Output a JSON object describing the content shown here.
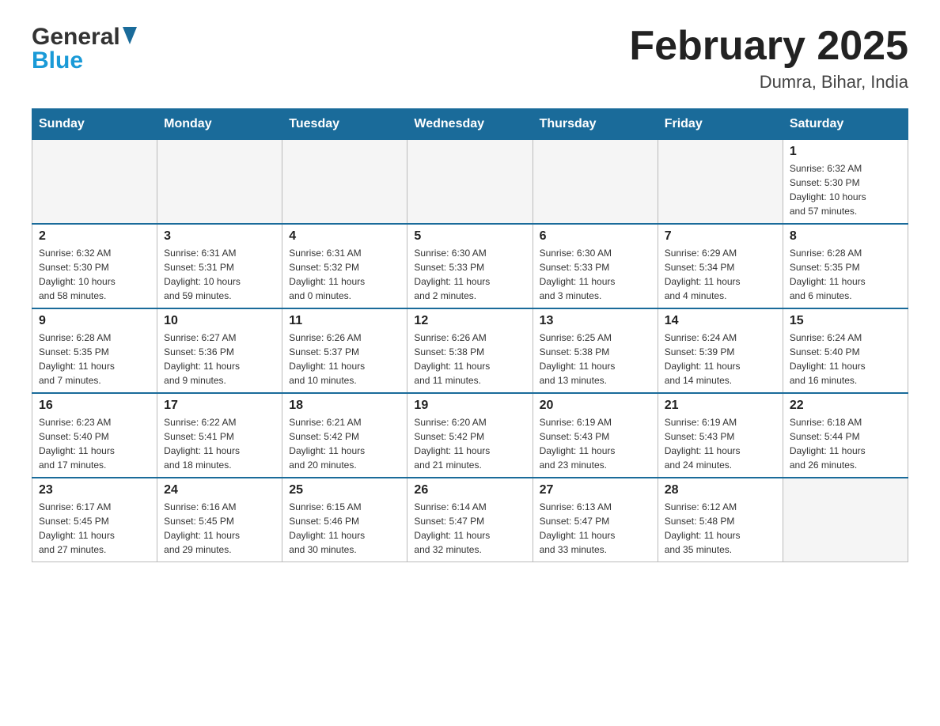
{
  "header": {
    "logo_general": "General",
    "logo_blue": "Blue",
    "title": "February 2025",
    "location": "Dumra, Bihar, India"
  },
  "calendar": {
    "days_of_week": [
      "Sunday",
      "Monday",
      "Tuesday",
      "Wednesday",
      "Thursday",
      "Friday",
      "Saturday"
    ],
    "weeks": [
      [
        {
          "day": "",
          "info": ""
        },
        {
          "day": "",
          "info": ""
        },
        {
          "day": "",
          "info": ""
        },
        {
          "day": "",
          "info": ""
        },
        {
          "day": "",
          "info": ""
        },
        {
          "day": "",
          "info": ""
        },
        {
          "day": "1",
          "info": "Sunrise: 6:32 AM\nSunset: 5:30 PM\nDaylight: 10 hours\nand 57 minutes."
        }
      ],
      [
        {
          "day": "2",
          "info": "Sunrise: 6:32 AM\nSunset: 5:30 PM\nDaylight: 10 hours\nand 58 minutes."
        },
        {
          "day": "3",
          "info": "Sunrise: 6:31 AM\nSunset: 5:31 PM\nDaylight: 10 hours\nand 59 minutes."
        },
        {
          "day": "4",
          "info": "Sunrise: 6:31 AM\nSunset: 5:32 PM\nDaylight: 11 hours\nand 0 minutes."
        },
        {
          "day": "5",
          "info": "Sunrise: 6:30 AM\nSunset: 5:33 PM\nDaylight: 11 hours\nand 2 minutes."
        },
        {
          "day": "6",
          "info": "Sunrise: 6:30 AM\nSunset: 5:33 PM\nDaylight: 11 hours\nand 3 minutes."
        },
        {
          "day": "7",
          "info": "Sunrise: 6:29 AM\nSunset: 5:34 PM\nDaylight: 11 hours\nand 4 minutes."
        },
        {
          "day": "8",
          "info": "Sunrise: 6:28 AM\nSunset: 5:35 PM\nDaylight: 11 hours\nand 6 minutes."
        }
      ],
      [
        {
          "day": "9",
          "info": "Sunrise: 6:28 AM\nSunset: 5:35 PM\nDaylight: 11 hours\nand 7 minutes."
        },
        {
          "day": "10",
          "info": "Sunrise: 6:27 AM\nSunset: 5:36 PM\nDaylight: 11 hours\nand 9 minutes."
        },
        {
          "day": "11",
          "info": "Sunrise: 6:26 AM\nSunset: 5:37 PM\nDaylight: 11 hours\nand 10 minutes."
        },
        {
          "day": "12",
          "info": "Sunrise: 6:26 AM\nSunset: 5:38 PM\nDaylight: 11 hours\nand 11 minutes."
        },
        {
          "day": "13",
          "info": "Sunrise: 6:25 AM\nSunset: 5:38 PM\nDaylight: 11 hours\nand 13 minutes."
        },
        {
          "day": "14",
          "info": "Sunrise: 6:24 AM\nSunset: 5:39 PM\nDaylight: 11 hours\nand 14 minutes."
        },
        {
          "day": "15",
          "info": "Sunrise: 6:24 AM\nSunset: 5:40 PM\nDaylight: 11 hours\nand 16 minutes."
        }
      ],
      [
        {
          "day": "16",
          "info": "Sunrise: 6:23 AM\nSunset: 5:40 PM\nDaylight: 11 hours\nand 17 minutes."
        },
        {
          "day": "17",
          "info": "Sunrise: 6:22 AM\nSunset: 5:41 PM\nDaylight: 11 hours\nand 18 minutes."
        },
        {
          "day": "18",
          "info": "Sunrise: 6:21 AM\nSunset: 5:42 PM\nDaylight: 11 hours\nand 20 minutes."
        },
        {
          "day": "19",
          "info": "Sunrise: 6:20 AM\nSunset: 5:42 PM\nDaylight: 11 hours\nand 21 minutes."
        },
        {
          "day": "20",
          "info": "Sunrise: 6:19 AM\nSunset: 5:43 PM\nDaylight: 11 hours\nand 23 minutes."
        },
        {
          "day": "21",
          "info": "Sunrise: 6:19 AM\nSunset: 5:43 PM\nDaylight: 11 hours\nand 24 minutes."
        },
        {
          "day": "22",
          "info": "Sunrise: 6:18 AM\nSunset: 5:44 PM\nDaylight: 11 hours\nand 26 minutes."
        }
      ],
      [
        {
          "day": "23",
          "info": "Sunrise: 6:17 AM\nSunset: 5:45 PM\nDaylight: 11 hours\nand 27 minutes."
        },
        {
          "day": "24",
          "info": "Sunrise: 6:16 AM\nSunset: 5:45 PM\nDaylight: 11 hours\nand 29 minutes."
        },
        {
          "day": "25",
          "info": "Sunrise: 6:15 AM\nSunset: 5:46 PM\nDaylight: 11 hours\nand 30 minutes."
        },
        {
          "day": "26",
          "info": "Sunrise: 6:14 AM\nSunset: 5:47 PM\nDaylight: 11 hours\nand 32 minutes."
        },
        {
          "day": "27",
          "info": "Sunrise: 6:13 AM\nSunset: 5:47 PM\nDaylight: 11 hours\nand 33 minutes."
        },
        {
          "day": "28",
          "info": "Sunrise: 6:12 AM\nSunset: 5:48 PM\nDaylight: 11 hours\nand 35 minutes."
        },
        {
          "day": "",
          "info": ""
        }
      ]
    ]
  }
}
